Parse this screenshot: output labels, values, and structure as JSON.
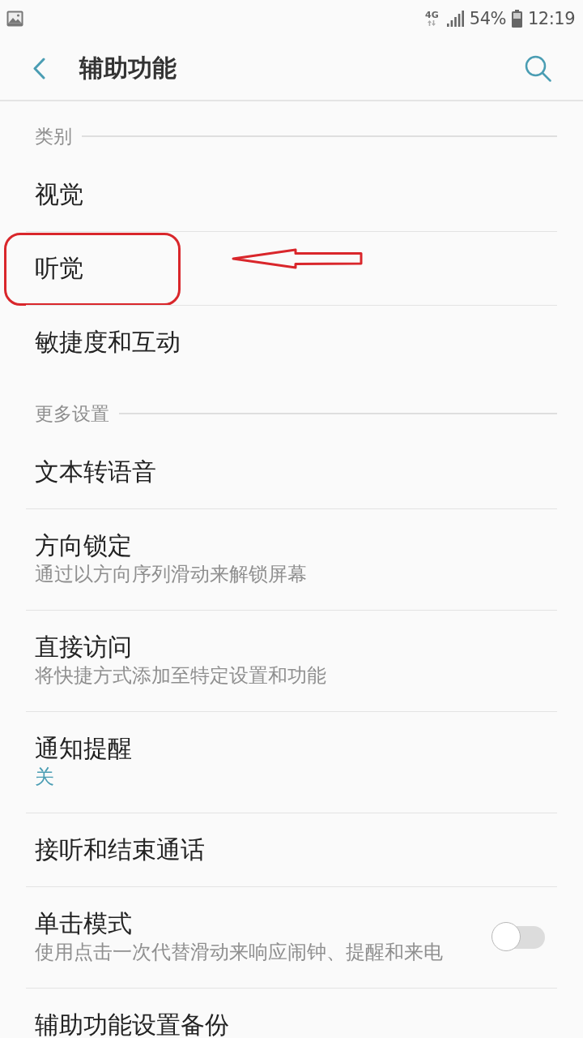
{
  "status_bar": {
    "network": "4G",
    "battery": "54%",
    "time": "12:19"
  },
  "header": {
    "title": "辅助功能"
  },
  "sections": [
    {
      "title": "类别",
      "items": [
        {
          "kind": "link",
          "title": "视觉",
          "annotated": false
        },
        {
          "kind": "link",
          "title": "听觉",
          "annotated": true
        },
        {
          "kind": "link",
          "title": "敏捷度和互动",
          "annotated": false
        }
      ]
    },
    {
      "title": "更多设置",
      "items": [
        {
          "kind": "link",
          "title": "文本转语音",
          "annotated": false
        },
        {
          "kind": "link",
          "title": "方向锁定",
          "summary": "通过以方向序列滑动来解锁屏幕",
          "annotated": false
        },
        {
          "kind": "link",
          "title": "直接访问",
          "summary": "将快捷方式添加至特定设置和功能",
          "annotated": false
        },
        {
          "kind": "link",
          "title": "通知提醒",
          "value": "关",
          "annotated": false
        },
        {
          "kind": "link",
          "title": "接听和结束通话",
          "annotated": false
        },
        {
          "kind": "toggle",
          "title": "单击模式",
          "summary": "使用点击一次代替滑动来响应闹钟、提醒和来电",
          "on": false,
          "annotated": false
        },
        {
          "kind": "link",
          "title": "辅助功能设置备份",
          "annotated": false
        }
      ]
    }
  ]
}
